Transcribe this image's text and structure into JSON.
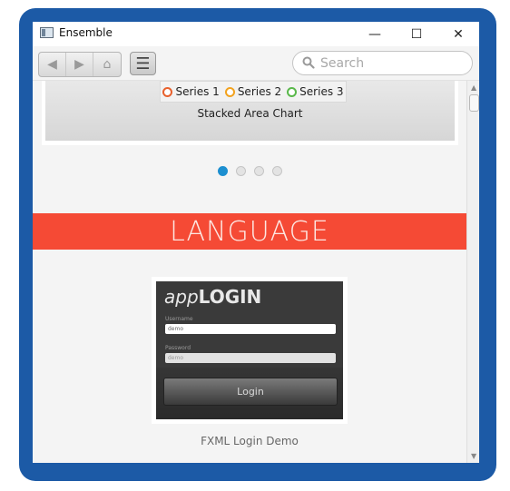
{
  "window": {
    "title": "Ensemble",
    "minimize": "—",
    "maximize": "☐",
    "close": "✕"
  },
  "toolbar": {
    "back_icon": "◀",
    "forward_icon": "▶",
    "home_icon": "⌂",
    "menu_icon": "☰",
    "search_placeholder": "Search"
  },
  "chart": {
    "legend": [
      {
        "label": "Series 1",
        "color": "#e8602c"
      },
      {
        "label": "Series 2",
        "color": "#f2a21e"
      },
      {
        "label": "Series 3",
        "color": "#59b84a"
      }
    ],
    "caption": "Stacked Area Chart"
  },
  "pager": {
    "pages": 4,
    "active": 1
  },
  "section": {
    "title": "LANGUAGE"
  },
  "login_demo": {
    "brand_prefix": "app",
    "brand_main": "LOGIN",
    "username_label": "Username",
    "username_value": "demo",
    "password_label": "Password",
    "password_value": "demo",
    "button_label": "Login",
    "caption": "FXML Login Demo"
  },
  "colors": {
    "frame": "#1c5aa6",
    "banner": "#f54a35",
    "pager_active": "#1c8fd0"
  }
}
